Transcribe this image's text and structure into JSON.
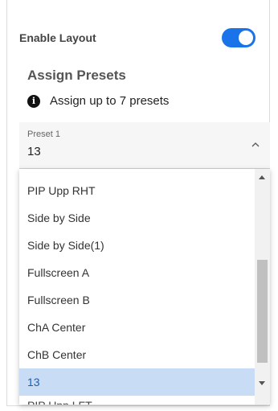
{
  "settings": {
    "enable_layout_label": "Enable Layout",
    "enable_layout_on": true,
    "assign_presets_title": "Assign Presets",
    "info_text": "Assign up to 7 presets"
  },
  "preset_select": {
    "label": "Preset 1",
    "value": "13",
    "options": [
      "PIP Upp RHT",
      "Side by Side",
      "Side by Side(1)",
      "Fullscreen A",
      "Fullscreen B",
      "ChA Center",
      "ChB Center",
      "13",
      "PIP Upp LFT"
    ],
    "selected_option": "13"
  },
  "colors": {
    "toggle_on": "#1a73e8",
    "selected_bg": "#c8dcf6",
    "selected_text": "#1a5fb4"
  }
}
